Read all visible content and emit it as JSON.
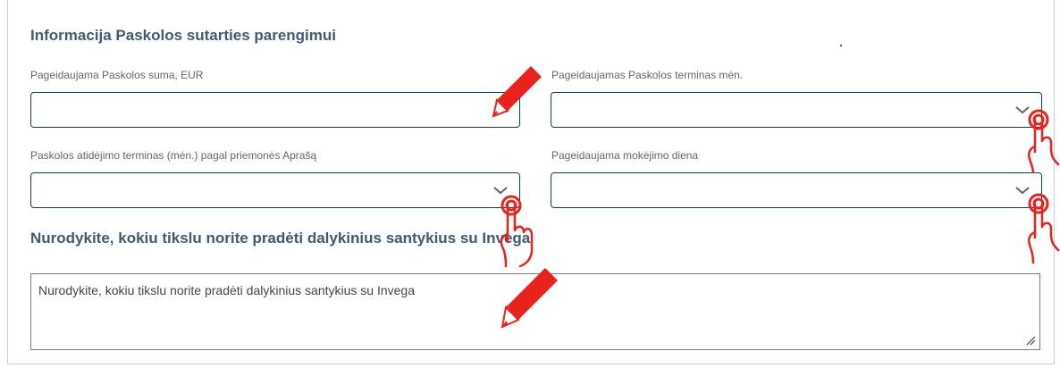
{
  "section": {
    "title": "Informacija Paskolos sutarties parengimui",
    "goal_title": "Nurodykite, kokiu tikslu norite pradėti dalykinius santykius su Invega"
  },
  "fields": {
    "loan_amount": {
      "label": "Pageidaujama Paskolos suma, EUR",
      "value": ""
    },
    "loan_term": {
      "label": "Pageidaujamas Paskolos terminas mėn.",
      "value": ""
    },
    "deferral_term": {
      "label": "Paskolos atidėjimo terminas (mėn.) pagal priemonės Aprašą",
      "value": ""
    },
    "payment_day": {
      "label": "Pageidaujama mokėjimo diena",
      "value": ""
    }
  },
  "goal_textarea": {
    "placeholder": "Nurodykite, kokiu tikslu norite pradėti dalykinius santykius su Invega"
  },
  "colors": {
    "title": "#3f5a73",
    "input_border": "#0e3a66",
    "annotation_red": "#e8231e"
  },
  "icons": {
    "chevron": "chevron-down-icon",
    "pencil": "pencil-icon",
    "hand": "pointing-hand-icon",
    "resize": "resize-handle-icon"
  }
}
